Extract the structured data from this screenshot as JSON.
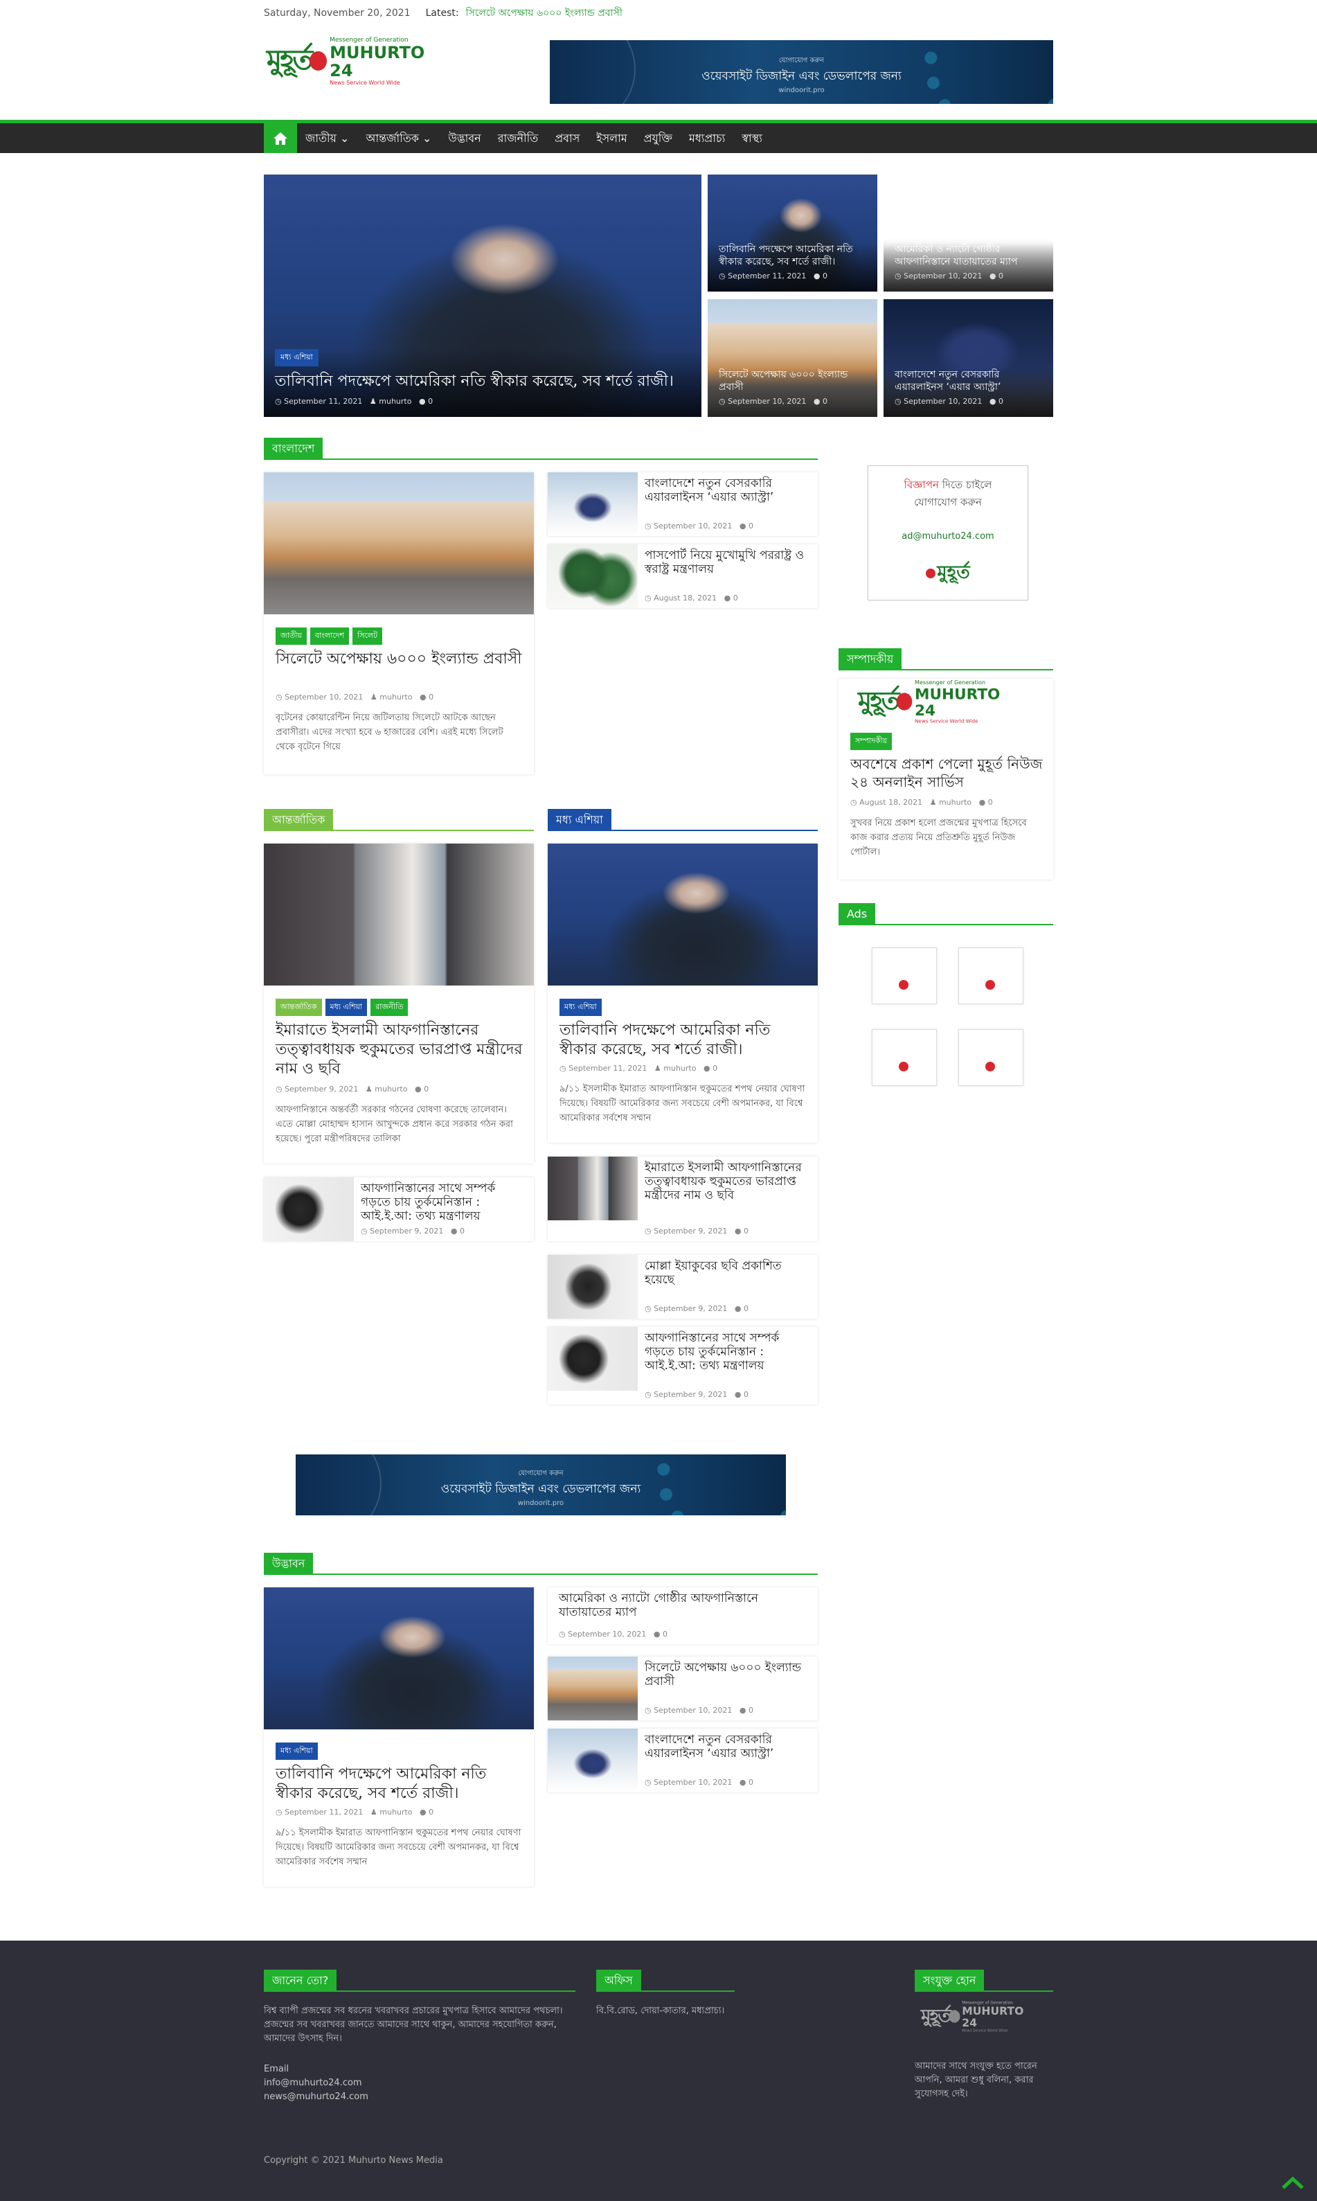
{
  "topbar": {
    "date": "Saturday, November 20, 2021",
    "latest_label": "Latest:",
    "latest_link": "সিলেটে অপেক্ষায় ৬০০০ ইংল্যান্ড প্রবাসী"
  },
  "logo": {
    "mark": "মুহূর্ত",
    "tag": "Messenger of Generation",
    "name": "MUHURTO 24",
    "sub": "News Service World Wide"
  },
  "header_banner": {
    "line1": "যোগাযোগ করুন",
    "line2": "ওয়েবসাইট ডিজাইন এবং ডেভলাপের জন্য",
    "line3": "windoorit.pro"
  },
  "nav": {
    "items": [
      "জাতীয় ⌄",
      "আন্তর্জাতিক ⌄",
      "উদ্ভাবন",
      "রাজনীতি",
      "প্রবাস",
      "ইসলাম",
      "প্রযুক্তি",
      "মধ্যপ্রাচ্য",
      "স্বাস্থ্য"
    ]
  },
  "featured": {
    "main": {
      "category": "মধ্য এশিয়া",
      "title": "তালিবানি পদক্ষেপে আমেরিকা নতি স্বীকার করেছে, সব শর্তে রাজী।",
      "date": "September 11, 2021",
      "author": "muhurto",
      "comments": "0"
    },
    "small": [
      {
        "title": "তালিবানি পদক্ষেপে আমেরিকা নতি স্বীকার করেছে, সব শর্তে রাজী।",
        "date": "September 11, 2021",
        "comments": "0"
      },
      {
        "title": "আমেরিকা ও ন্যাটো গোষ্ঠীর আফগানিস্তানে যাতায়াতের ম্যাপ",
        "date": "September 10, 2021",
        "comments": "0"
      },
      {
        "title": "সিলেটে অপেক্ষায় ৬০০০ ইংল্যান্ড প্রবাসী",
        "date": "September 10, 2021",
        "comments": "0"
      },
      {
        "title": "বাংলাদেশে নতুন বেসরকারি এয়ারলাইনস ‘এয়ার অ্যাস্ট্রা’",
        "date": "September 10, 2021",
        "comments": "0"
      }
    ]
  },
  "bangladesh": {
    "heading": "বাংলাদেশ",
    "main": {
      "tags": [
        "জাতীয়",
        "বাংলাদেশ",
        "সিলেট"
      ],
      "title": "সিলেটে অপেক্ষায় ৬০০০ ইংল্যান্ড প্রবাসী",
      "date": "September 10, 2021",
      "author": "muhurto",
      "comments": "0",
      "excerpt": "বৃটেনের কোয়ারেন্টিন নিয়ে জটিলতায় সিলেটে আটকে আছেন প্রবাসীরা। এদের সংখ্যা হবে ৬ হাজারের বেশি। এরই মধ্যে সিলেট থেকে বৃটেনে গিয়ে"
    },
    "list": [
      {
        "title": "বাংলাদেশে নতুন বেসরকারি এয়ারলাইনস ‘এয়ার অ্যাস্ট্রা’",
        "date": "September 10, 2021",
        "comments": "0"
      },
      {
        "title": "পাসপোর্ট নিয়ে মুখোমুখি পররাষ্ট্র ও স্বরাষ্ট্র মন্ত্রণালয়",
        "date": "August 18, 2021",
        "comments": "0"
      }
    ]
  },
  "sidebar": {
    "ad": {
      "line1_red": "বিজ্ঞাপন",
      "line1_rest": " দিতে চাইলে",
      "line2": "যোগাযোগ করুন",
      "email": "ad@muhurto24.com"
    },
    "editorial": {
      "heading": "সম্পাদকীয়",
      "tag": "সম্পাদকীয়",
      "title": "অবশেষে প্রকাশ পেলো মুহূর্ত নিউজ ২৪ অনলাইন সার্ভিস",
      "date": "August 18, 2021",
      "author": "muhurto",
      "comments": "0",
      "excerpt": "সুখবর নিয়ে প্রকাশ হলো প্রজন্মের মুখপাত্র হিসেবে কাজ করার প্রত্যয় নিয়ে প্রতিশ্রুতি মুহূর্ত নিউজ পোর্টাল।"
    },
    "ads_heading": "Ads"
  },
  "international": {
    "heading": "আন্তর্জাতিক",
    "main": {
      "tags": [
        "আন্তর্জাতিক",
        "মধ্য এশিয়া",
        "রাজনীতি"
      ],
      "title": "ইমারাতে ইসলামী আফগানিস্তানের তত্ত্বাবধায়ক হুকুমতের ভারপ্রাপ্ত মন্ত্রীদের নাম ও ছবি",
      "date": "September 9, 2021",
      "author": "muhurto",
      "comments": "0",
      "excerpt": "আফগানিস্তানে অন্তর্বর্তী সরকার গঠনের ঘোষণা করেছে তালেবান। এতে মোল্লা মোহাম্মদ হাসান আখুন্দকে প্রধান করে সরকার গঠন করা হয়েছে। পুরো মন্ত্রীপরিষদের তালিকা"
    },
    "list": [
      {
        "title": "আফগানিস্তানের সাথে সম্পর্ক গড়তে চায় তুর্কমেনিস্তান : আই.ই.আ: তথ্য মন্ত্রণালয়",
        "date": "September 9, 2021",
        "comments": "0"
      }
    ]
  },
  "central_asia": {
    "heading": "মধ্য এশিয়া",
    "main": {
      "tags": [
        "মধ্য এশিয়া"
      ],
      "title": "তালিবানি পদক্ষেপে আমেরিকা নতি স্বীকার করেছে, সব শর্তে রাজী।",
      "date": "September 11, 2021",
      "author": "muhurto",
      "comments": "0",
      "excerpt": "৯/১১ ইসলামীক ইমারাত আফগানিস্তান হুকুমতের শপথ নেয়ার ঘোষণা দিয়েছে। বিষয়টি আমেরিকার জন্য সবচেয়ে বেশী অপমানকর, যা বিশ্বে আমেরিকার সর্বশেষ সম্মান"
    },
    "list": [
      {
        "title": "ইমারাতে ইসলামী আফগানিস্তানের তত্ত্বাবধায়ক হুকুমতের ভারপ্রাপ্ত মন্ত্রীদের নাম ও ছবি",
        "date": "September 9, 2021",
        "comments": "0"
      },
      {
        "title": "মোল্লা ইয়াকুবের ছবি প্রকাশিত হয়েছে",
        "date": "September 9, 2021",
        "comments": "0"
      },
      {
        "title": "আফগানিস্তানের সাথে সম্পর্ক গড়তে চায় তুর্কমেনিস্তান : আই.ই.আ: তথ্য মন্ত্রণালয়",
        "date": "September 9, 2021",
        "comments": "0"
      }
    ]
  },
  "mid_banner": {
    "line1": "যোগাযোগ করুন",
    "line2": "ওয়েবসাইট ডিজাইন এবং ডেভলাপের জন্য",
    "line3": "windoorit.pro"
  },
  "innovation": {
    "heading": "উদ্ভাবন",
    "main": {
      "tags": [
        "মধ্য এশিয়া"
      ],
      "title": "তালিবানি পদক্ষেপে আমেরিকা নতি স্বীকার করেছে, সব শর্তে রাজী।",
      "date": "September 11, 2021",
      "author": "muhurto",
      "comments": "0",
      "excerpt": "৯/১১ ইসলামীক ইমারাত আফগানিস্তান হুকুমতের শপথ নেয়ার ঘোষণা দিয়েছে। বিষয়টি আমেরিকার জন্য সবচেয়ে বেশী অপমানকর, যা বিশ্বে আমেরিকার সর্বশেষ সম্মান"
    },
    "list": [
      {
        "title": "আমেরিকা ও ন্যাটো গোষ্ঠীর আফগানিস্তানে যাতায়াতের ম্যাপ",
        "date": "September 10, 2021",
        "comments": "0"
      },
      {
        "title": "সিলেটে অপেক্ষায় ৬০০০ ইংল্যান্ড প্রবাসী",
        "date": "September 10, 2021",
        "comments": "0"
      },
      {
        "title": "বাংলাদেশে নতুন বেসরকারি এয়ারলাইনস ‘এয়ার অ্যাস্ট্রা’",
        "date": "September 10, 2021",
        "comments": "0"
      }
    ]
  },
  "footer": {
    "about_heading": "জানেন তো?",
    "about_text": "বিশ্ব ব্যাপী প্রজন্মের সব ধরনের খবরাখবর প্রচারের মুখপাত্র হিসাবে আমাদের পথচলা। প্রজন্মের সব খবরাখবর জানতে আমাদের সাথে থাকুন, আমাদের সহযোগিতা করুন, আমাদের উৎসাহ দিন।",
    "email_label": "Email",
    "email1": "info@muhurto24.com",
    "email2": "news@muhurto24.com",
    "office_heading": "অফিস",
    "office_text": "বি.বি.রোড, দোয়া-কাতার, মধ্যপ্রাচ্য।",
    "join_heading": "সংযুক্ত হোন",
    "join_text": "আমাদের সাথে সংযুক্ত হতে পারেন আপনি, আমরা শুধু বলিনা, করার সুযোগসহ দেই।",
    "copyright_prefix": "Copyright © 2021",
    "copyright_link": "Muhurto News Media"
  },
  "colors": {
    "accent": "#22b02f",
    "blue": "#1b4fa8",
    "nav_bg": "#2a2a2a",
    "footer_bg": "#2f2f3a"
  }
}
